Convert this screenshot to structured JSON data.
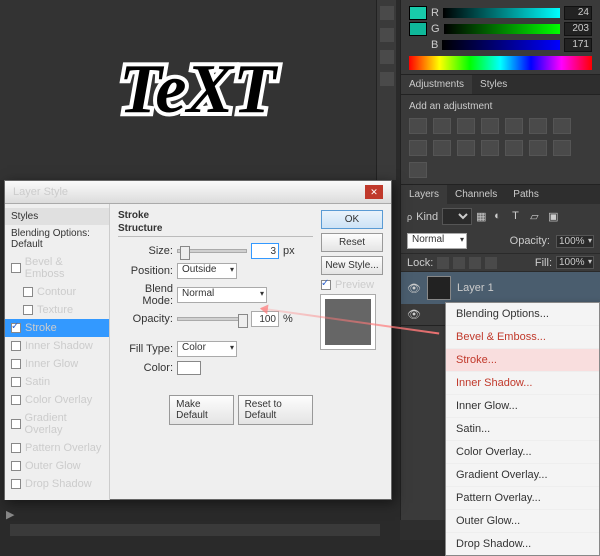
{
  "canvas": {
    "text": "TeXT"
  },
  "color": {
    "r_label": "R",
    "g_label": "G",
    "b_label": "B",
    "r": "24",
    "g": "203",
    "b": "171",
    "swatch": "#18cbab",
    "swatch2": "#0fb89a"
  },
  "adjustments": {
    "tab1": "Adjustments",
    "tab2": "Styles",
    "title": "Add an adjustment"
  },
  "layers": {
    "tab1": "Layers",
    "tab2": "Channels",
    "tab3": "Paths",
    "kind": "Kind",
    "kind_val": "",
    "mode": "Normal",
    "opacity_label": "Opacity:",
    "opacity": "100%",
    "lock": "Lock:",
    "fill_label": "Fill:",
    "fill": "100%",
    "layer1": "Layer 1"
  },
  "fx_menu": {
    "blending": "Blending Options...",
    "bevel": "Bevel & Emboss...",
    "stroke": "Stroke...",
    "inner_shadow": "Inner Shadow...",
    "inner_glow": "Inner Glow...",
    "satin": "Satin...",
    "color_overlay": "Color Overlay...",
    "gradient_overlay": "Gradient Overlay...",
    "pattern_overlay": "Pattern Overlay...",
    "outer_glow": "Outer Glow...",
    "drop_shadow": "Drop Shadow..."
  },
  "dialog": {
    "title": "Layer Style",
    "styles_head": "Styles",
    "blending_default": "Blending Options: Default",
    "items": {
      "bevel": "Bevel & Emboss",
      "contour": "Contour",
      "texture": "Texture",
      "stroke": "Stroke",
      "inner_shadow": "Inner Shadow",
      "inner_glow": "Inner Glow",
      "satin": "Satin",
      "color_overlay": "Color Overlay",
      "gradient_overlay": "Gradient Overlay",
      "pattern_overlay": "Pattern Overlay",
      "outer_glow": "Outer Glow",
      "drop_shadow": "Drop Shadow"
    },
    "section_stroke": "Stroke",
    "section_structure": "Structure",
    "size_label": "Size:",
    "size_val": "3",
    "size_unit": "px",
    "position_label": "Position:",
    "position_val": "Outside",
    "blend_label": "Blend Mode:",
    "blend_val": "Normal",
    "opacity_label": "Opacity:",
    "opacity_val": "100",
    "opacity_unit": "%",
    "filltype_label": "Fill Type:",
    "filltype_val": "Color",
    "color_label": "Color:",
    "make_default": "Make Default",
    "reset_default": "Reset to Default",
    "ok": "OK",
    "reset": "Reset",
    "new_style": "New Style...",
    "preview": "Preview"
  }
}
